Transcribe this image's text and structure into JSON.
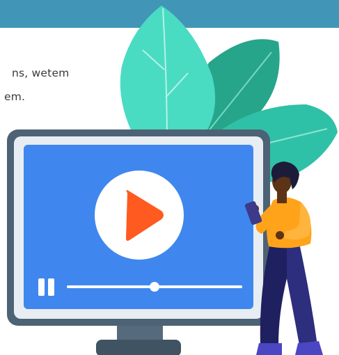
{
  "body_text": {
    "line1": "ns, wetem",
    "line2": "em."
  },
  "video_player": {
    "play_state": "paused",
    "progress": 0.5
  },
  "colors": {
    "header_band": "#4196b7",
    "screen": "#3f87ee",
    "monitor_frame": "#4d6274",
    "play_icon": "#ff5a1f",
    "leaf_light": "#49dcc3",
    "leaf_dark": "#27a58b",
    "shirt": "#ffa31a",
    "pants": "#1f2060"
  }
}
